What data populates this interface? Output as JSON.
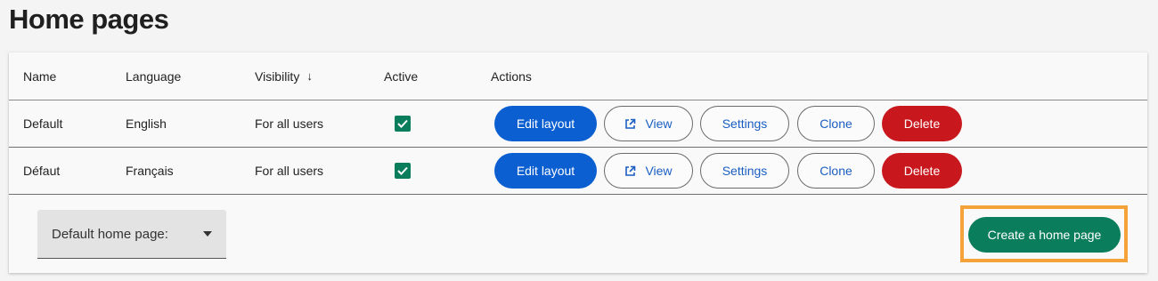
{
  "page": {
    "title": "Home pages"
  },
  "table": {
    "headers": {
      "name": "Name",
      "language": "Language",
      "visibility": "Visibility",
      "active": "Active",
      "actions": "Actions"
    },
    "rows": [
      {
        "name": "Default",
        "language": "English",
        "visibility": "For all users",
        "active": true
      },
      {
        "name": "Défaut",
        "language": "Français",
        "visibility": "For all users",
        "active": true
      }
    ],
    "actions": {
      "edit_layout": "Edit layout",
      "view": "View",
      "settings": "Settings",
      "clone": "Clone",
      "delete": "Delete"
    }
  },
  "footer": {
    "default_select_label": "Default home page:",
    "create_button": "Create a home page"
  },
  "colors": {
    "primary": "#0b5fd1",
    "success": "#0a7d5c",
    "danger": "#c8181e",
    "highlight": "#f5a23a"
  },
  "icons": {
    "sort": "arrow-down-icon",
    "view": "external-link-icon",
    "checkbox": "checkmark-icon",
    "select": "caret-down-icon"
  }
}
